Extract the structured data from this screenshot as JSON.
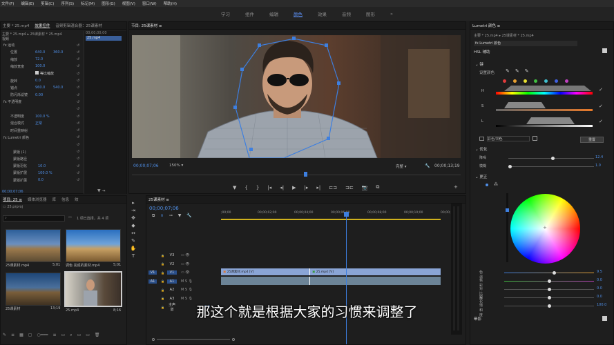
{
  "menu": [
    "文件(F)",
    "编辑(E)",
    "剪辑(C)",
    "序列(S)",
    "标记(M)",
    "图形(G)",
    "视图(V)",
    "窗口(W)",
    "帮助(H)"
  ],
  "workspaces": {
    "items": [
      "学习",
      "组件",
      "编辑",
      "颜色",
      "效果",
      "音频",
      "图形"
    ],
    "active": "颜色",
    "more": "»"
  },
  "source_panel": {
    "tabs": [
      "主要 * 25.mp4",
      "效果控件",
      "音频剪辑混合器：25课素材",
      "元数据"
    ],
    "clip_header": "主要 * 25.mp4 ▸ 25课素材 * 25.mp4",
    "timecode_top": "00;00;00;00",
    "clip_label": "25.mp4",
    "video_label": "视频",
    "rows": [
      {
        "label": "fx 运动"
      },
      {
        "label": "位置",
        "val1": "640.0",
        "val2": "360.0"
      },
      {
        "label": "缩放",
        "val1": "72.0"
      },
      {
        "label": "缩放宽度",
        "val1": "100.0"
      },
      {
        "label": "",
        "check": "等比缩放"
      },
      {
        "label": "旋转",
        "val1": "0.0"
      },
      {
        "label": "锚点",
        "val1": "960.0",
        "val2": "540.0"
      },
      {
        "label": "防闪烁滤镜",
        "val1": "0.00"
      },
      {
        "label": "fx 不透明度"
      },
      {
        "label": ""
      },
      {
        "label": "不透明度",
        "val1": "100.0 %"
      },
      {
        "label": "混合模式",
        "val1": "正常"
      },
      {
        "label": "时间重映射"
      },
      {
        "label": "fx Lumetri 颜色"
      },
      {
        "label": ""
      },
      {
        "label": "蒙版 (1)"
      },
      {
        "label": "蒙版路径"
      },
      {
        "label": "蒙版羽化",
        "val1": "10.0"
      },
      {
        "label": "蒙版扩展",
        "val1": "100.0 %"
      },
      {
        "label": "蒙版扩展",
        "val1": "0.0"
      }
    ],
    "timecode_bottom": "00;00;07;06"
  },
  "program": {
    "title": "节目: 25课素材 ≡",
    "timecode": "00;00;07;06",
    "zoom": "150%",
    "quality": "完整",
    "duration": "00;00;13;19"
  },
  "project": {
    "tabs": [
      "项目: 25 ≡",
      "媒体浏览器",
      "库",
      "信息",
      "效"
    ],
    "file": "25.prproj",
    "selection": "1 项已选择，共 4 项",
    "items": [
      {
        "name": "25课素材.mp4",
        "dur": "5;01"
      },
      {
        "name": "调色 完成的素材.mp4",
        "dur": "5;01"
      },
      {
        "name": "25课素材",
        "dur": "13;19"
      },
      {
        "name": "25.mp4",
        "dur": "8;16"
      }
    ]
  },
  "timeline": {
    "title": "25课素材 ≡",
    "timecode": "00;00;07;06",
    "ruler": [
      ";00;00",
      "00;00;02;00",
      "00;00;04;00",
      "00;00;06;00",
      "00;00;08;00",
      "00;00;10;00",
      "00;00;12;00"
    ],
    "tracks": [
      {
        "name": "V3"
      },
      {
        "name": "V2"
      },
      {
        "name": "V1",
        "src": "V1"
      },
      {
        "name": "A1",
        "src": "A1"
      },
      {
        "name": "A2"
      },
      {
        "name": "A3"
      },
      {
        "name": "主声道",
        "val": "0.0"
      }
    ],
    "clips": [
      {
        "label": "25课素材.mp4 [V]"
      },
      {
        "label": "25.mp4 [V]"
      }
    ]
  },
  "subtitle": "那这个就是根据大家的习惯来调整了",
  "lumetri": {
    "title": "Lumetri 颜色 ≡",
    "clip_path": "主要 * 25.mp4 ▸ 25课素材 * 25.mp4",
    "fx_label": "fx  Lumetri 颜色",
    "section": "HSL 辅助",
    "key_label": "键",
    "set_color": "设置颜色",
    "h": "H",
    "s": "S",
    "l": "L",
    "color_gray": "彩色/灰色",
    "reset": "重置",
    "refine_section": "优化",
    "denoise": {
      "label": "降噪",
      "val": "12.4"
    },
    "blur": {
      "label": "模糊",
      "val": "1.0"
    },
    "correction": "更正",
    "sliders": [
      {
        "label": "色温",
        "val": "9.5",
        "pos": 0.55
      },
      {
        "label": "色彩",
        "val": "0.0",
        "pos": 0.5
      },
      {
        "label": "对比度",
        "val": "0.0",
        "pos": 0.5
      },
      {
        "label": "锐化",
        "val": "0.0",
        "pos": 0.5
      },
      {
        "label": "饱和度",
        "val": "100.0",
        "pos": 0.5
      }
    ],
    "vignette": "晕影",
    "colors": {
      "accent": "#4f8fe8",
      "active_tab": "#5b8ef0"
    }
  }
}
